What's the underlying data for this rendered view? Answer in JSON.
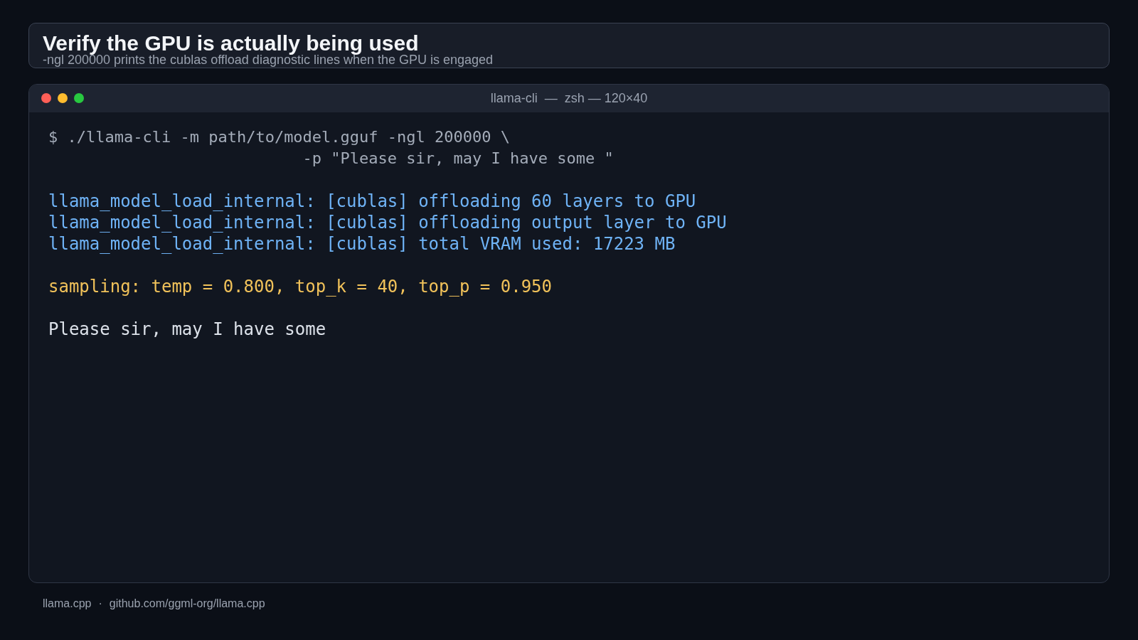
{
  "header": {
    "title": "Verify the GPU is actually being used",
    "subtitle": "-ngl 200000 prints the cublas offload diagnostic lines when the GPU is engaged"
  },
  "terminal": {
    "title": "llama-cli  —  zsh — 120×40",
    "blocks": [
      {
        "kind": "command",
        "lines": [
          {
            "text": "$ ./llama-cli -m path/to/model.gguf -ngl 200000 \\",
            "indented": false
          },
          {
            "text": "-p \"Please sir, may I have some \"",
            "indented": true
          }
        ]
      },
      {
        "kind": "log",
        "lines": [
          {
            "text": "llama_model_load_internal: [cublas] offloading 60 layers to GPU",
            "indented": false
          },
          {
            "text": "llama_model_load_internal: [cublas] offloading output layer to GPU",
            "indented": false
          },
          {
            "text": "llama_model_load_internal: [cublas] total VRAM used: 17223 MB",
            "indented": false
          }
        ]
      },
      {
        "kind": "sampling",
        "lines": [
          {
            "text": "sampling: temp = 0.800, top_k = 40, top_p = 0.950",
            "indented": false
          }
        ]
      },
      {
        "kind": "output",
        "lines": [
          {
            "text": "Please sir, may I have some",
            "indented": false
          }
        ]
      }
    ]
  },
  "footer": {
    "project": "llama.cpp",
    "separator": "·",
    "url": "github.com/ggml-org/llama.cpp"
  }
}
